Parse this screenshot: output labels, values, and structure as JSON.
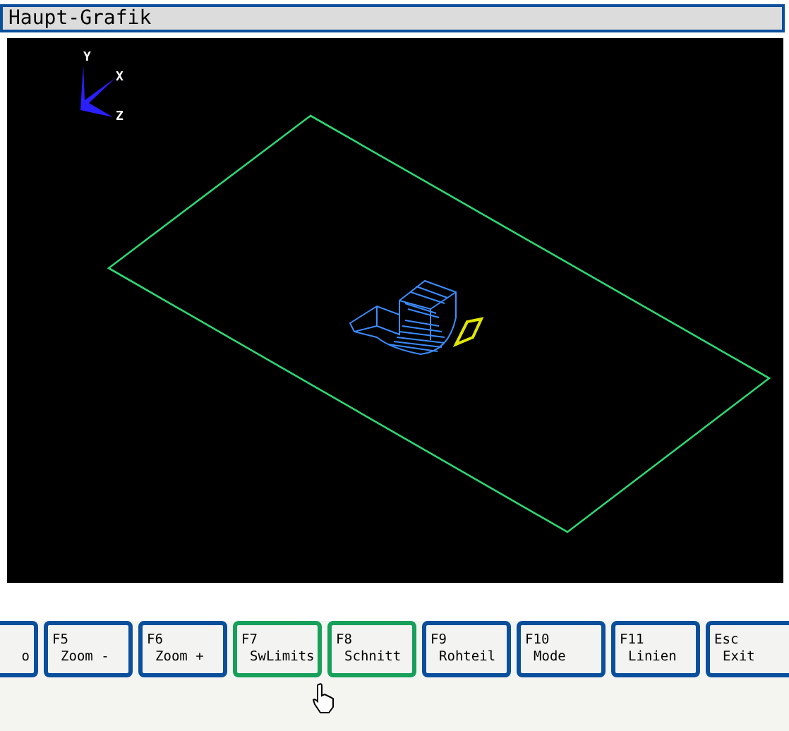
{
  "window": {
    "title": "Haupt-Grafik"
  },
  "viewport": {
    "axis_labels": [
      "X",
      "Y",
      "Z"
    ]
  },
  "function_keys": [
    {
      "label": "o",
      "highlighted": false
    },
    {
      "key": "F5",
      "label": "Zoom -",
      "highlighted": false
    },
    {
      "key": "F6",
      "label": "Zoom +",
      "highlighted": false
    },
    {
      "key": "F7",
      "label": "SwLimits",
      "highlighted": true
    },
    {
      "key": "F8",
      "label": "Schnitt",
      "highlighted": true
    },
    {
      "key": "F9",
      "label": "Rohteil",
      "highlighted": false
    },
    {
      "key": "F10",
      "label": "Mode",
      "highlighted": false
    },
    {
      "key": "F11",
      "label": "Linien",
      "highlighted": false
    },
    {
      "key": "Esc",
      "label": "Exit",
      "highlighted": false
    }
  ]
}
